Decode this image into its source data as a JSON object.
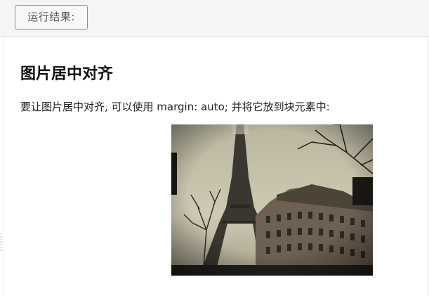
{
  "toolbar": {
    "result_button_label": "运行结果:"
  },
  "content": {
    "title": "图片居中对齐",
    "description": "要让图片居中对齐, 可以使用 margin: auto; 并将它放到块元素中:"
  }
}
